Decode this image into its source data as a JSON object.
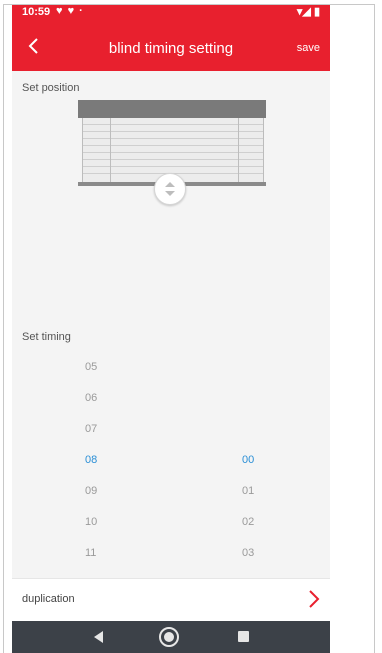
{
  "status_bar": {
    "time": "10:59",
    "left_icons": "♥ ♥ ·",
    "right_icons": "▾◢ ▮"
  },
  "app_bar": {
    "title": "blind timing setting",
    "save_label": "save",
    "back_icon": "chevron-left-icon"
  },
  "position_section": {
    "label": "Set position"
  },
  "timing_section": {
    "label": "Set timing"
  },
  "picker": {
    "hours": [
      "05",
      "06",
      "07",
      "08",
      "09",
      "10",
      "11"
    ],
    "minutes": [
      "00",
      "01",
      "02",
      "03"
    ],
    "selected_hour": "08",
    "selected_minute": "00",
    "selected_color": "#2b8fd6"
  },
  "duplication": {
    "label": "duplication",
    "chevron_icon": "chevron-right-icon",
    "accent": "#e8202e"
  },
  "colors": {
    "brand": "#e8202e",
    "nav_bar": "#3c4148"
  }
}
